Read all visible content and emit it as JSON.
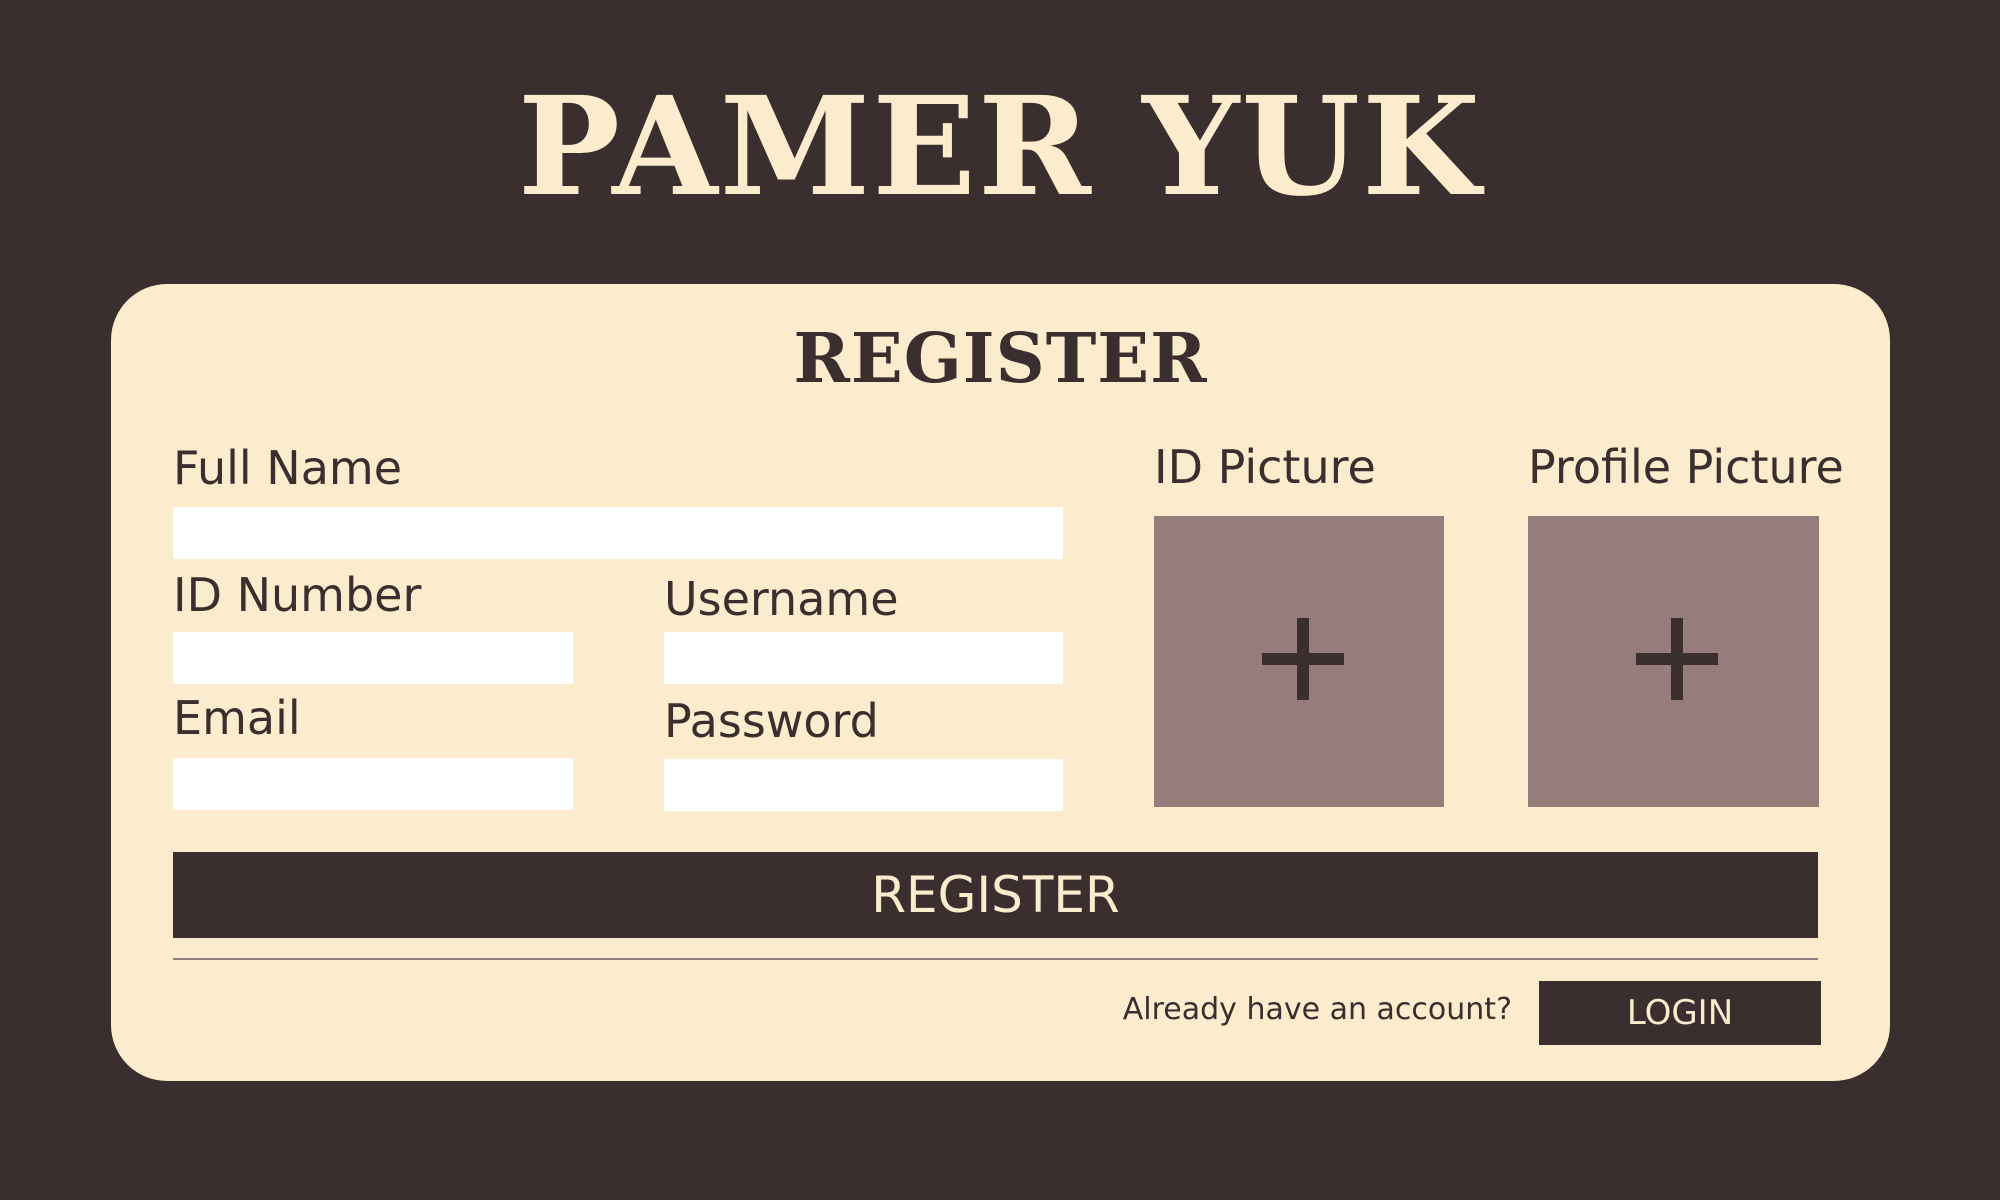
{
  "app": {
    "title": "PAMER YUK"
  },
  "form": {
    "title": "REGISTER",
    "fields": {
      "full_name": {
        "label": "Full Name",
        "value": ""
      },
      "id_number": {
        "label": "ID Number",
        "value": ""
      },
      "username": {
        "label": "Username",
        "value": ""
      },
      "email": {
        "label": "Email",
        "value": ""
      },
      "password": {
        "label": "Password",
        "value": ""
      }
    },
    "uploads": {
      "id_picture": {
        "label": "ID Picture",
        "icon": "plus-icon"
      },
      "profile_picture": {
        "label": "Profile Picture",
        "icon": "plus-icon"
      }
    },
    "register_button": "REGISTER",
    "account_prompt": "Already have an account?",
    "login_button": "LOGIN"
  },
  "colors": {
    "background": "#3a2e2e",
    "card": "#fbeccd",
    "input": "#ffffff",
    "upload_box": "#967c7b",
    "button": "#3a2e2e",
    "button_text": "#fbeccd"
  }
}
